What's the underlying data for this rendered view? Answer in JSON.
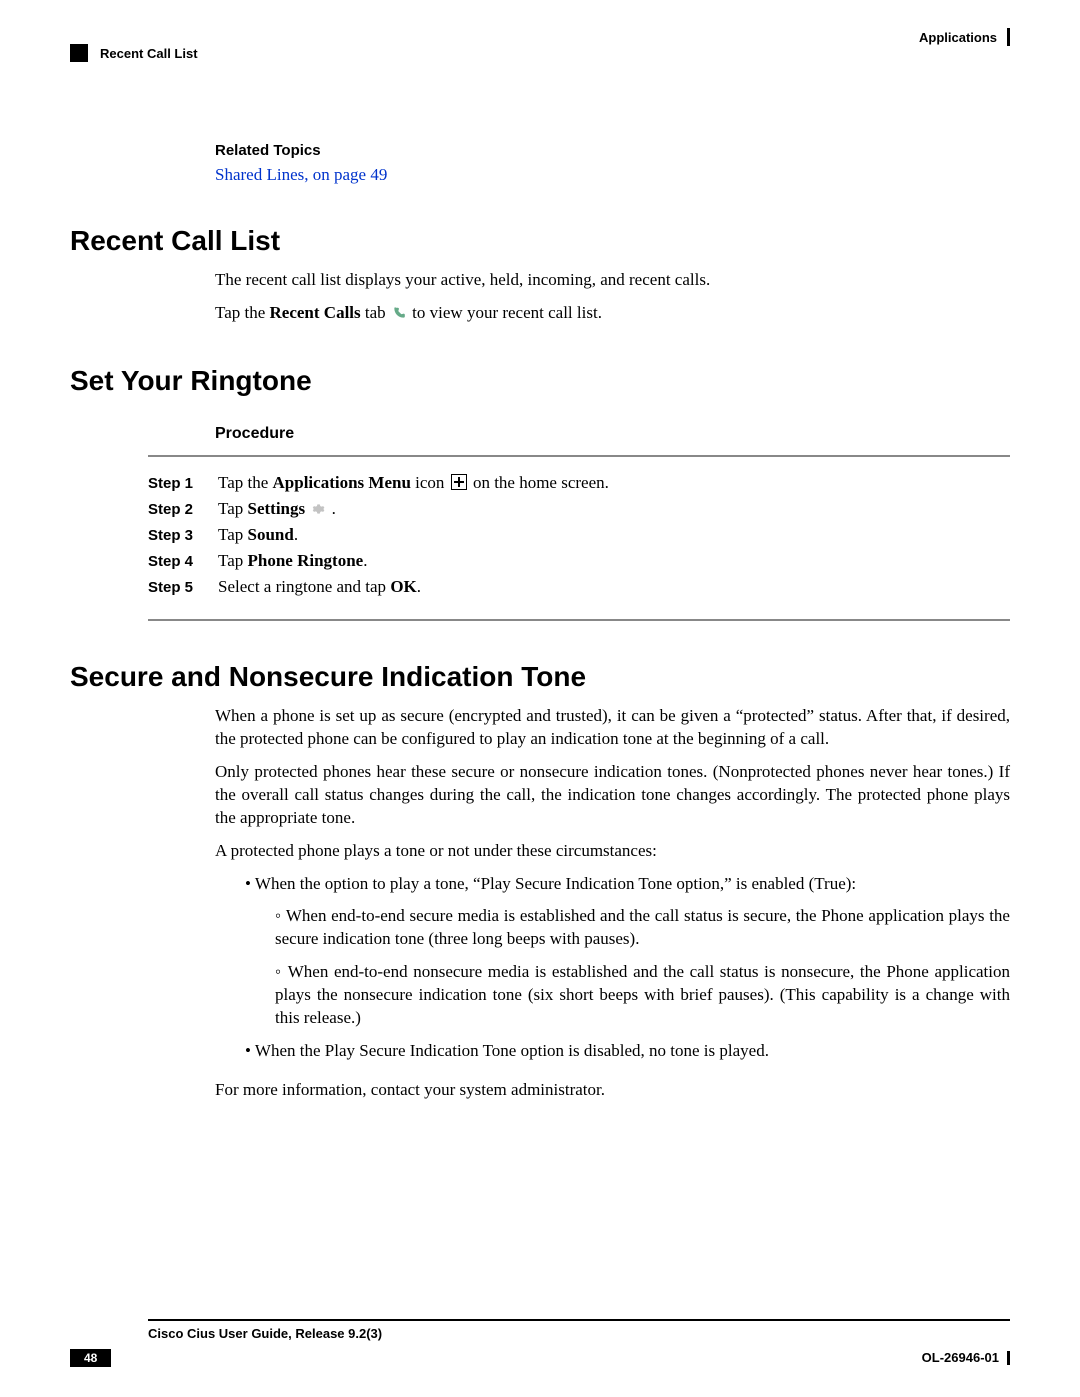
{
  "header": {
    "right_label": "Applications",
    "left_label": "Recent Call List"
  },
  "related_topics": {
    "heading": "Related Topics",
    "link": "Shared Lines,  on page 49"
  },
  "sections": {
    "recent_call_list": {
      "title": "Recent Call List",
      "p1": "The recent call list displays your active, held, incoming, and recent calls.",
      "p2_pre": "Tap the ",
      "p2_bold1": "Recent Calls",
      "p2_mid": " tab ",
      "p2_post": " to view your recent call list."
    },
    "set_ringtone": {
      "title": "Set Your Ringtone",
      "procedure_heading": "Procedure",
      "steps": [
        {
          "label": "Step 1",
          "pre": "Tap the ",
          "bold": "Applications Menu",
          "mid": " icon ",
          "post": " on the home screen.",
          "icon": "apps"
        },
        {
          "label": "Step 2",
          "pre": "Tap ",
          "bold": "Settings",
          "mid": " ",
          "post": " .",
          "icon": "gear"
        },
        {
          "label": "Step 3",
          "pre": "Tap ",
          "bold": "Sound",
          "mid": "",
          "post": ".",
          "icon": ""
        },
        {
          "label": "Step 4",
          "pre": "Tap ",
          "bold": "Phone Ringtone",
          "mid": "",
          "post": ".",
          "icon": ""
        },
        {
          "label": "Step 5",
          "pre": "Select a ringtone and tap ",
          "bold": "OK",
          "mid": "",
          "post": ".",
          "icon": ""
        }
      ]
    },
    "secure_tone": {
      "title": "Secure and Nonsecure Indication Tone",
      "p1": "When a phone is set up as secure (encrypted and trusted), it can be given a “protected” status. After that, if desired, the protected phone can be configured to play an indication tone at the beginning of a call.",
      "p2": "Only protected phones hear these secure or nonsecure indication tones. (Nonprotected phones never hear tones.) If the overall call status changes during the call, the indication tone changes accordingly. The protected phone plays the appropriate tone.",
      "p3": "A protected phone plays a tone or not under these circumstances:",
      "b1": "When the option to play a tone, “Play Secure Indication Tone option,” is enabled (True):",
      "b1a": "When end-to-end secure media is established and the call status is secure, the Phone application plays the secure indication tone (three long beeps with pauses).",
      "b1b": "When end-to-end nonsecure media is established and the call status is nonsecure, the Phone application plays the nonsecure indication tone (six short beeps with brief pauses). (This capability is a change with this release.)",
      "b2": "When the Play Secure Indication Tone option is disabled, no tone is played.",
      "p4": "For more information, contact your system administrator."
    }
  },
  "footer": {
    "doc_title": "Cisco Cius User Guide, Release 9.2(3)",
    "page_number": "48",
    "doc_id": "OL-26946-01"
  }
}
